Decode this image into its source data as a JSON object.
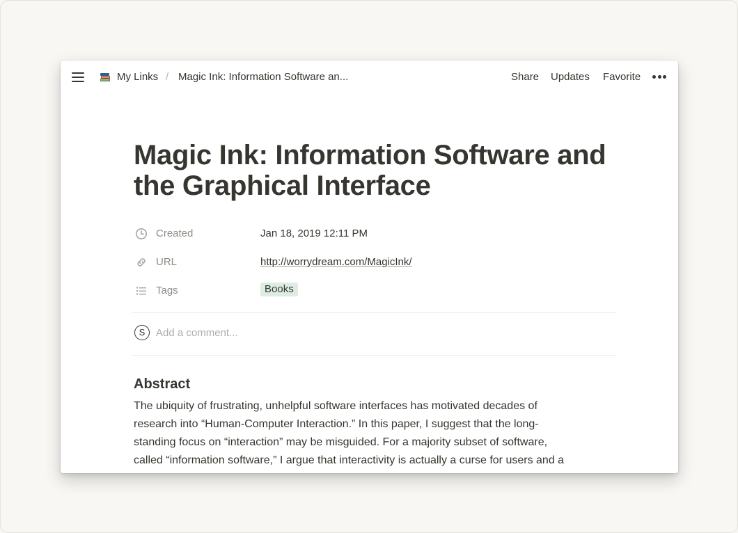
{
  "topbar": {
    "breadcrumb": [
      {
        "label": "My Links",
        "icon": "books-icon"
      },
      {
        "label": "Magic Ink: Information Software an..."
      }
    ],
    "separator": "/",
    "actions": {
      "share": "Share",
      "updates": "Updates",
      "favorite": "Favorite"
    }
  },
  "page": {
    "title": "Magic Ink: Information Software and the Graphical Interface",
    "properties": {
      "created": {
        "label": "Created",
        "value": "Jan 18, 2019 12:11 PM",
        "icon": "clock-icon"
      },
      "url": {
        "label": "URL",
        "value": "http://worrydream.com/MagicInk/",
        "icon": "link-icon"
      },
      "tags": {
        "label": "Tags",
        "value": "Books",
        "icon": "list-icon"
      }
    },
    "comment": {
      "avatar_initial": "S",
      "placeholder": "Add a comment..."
    },
    "body": {
      "heading": "Abstract",
      "lines": [
        "The ubiquity of frustrating, unhelpful software interfaces has motivated decades of",
        "research into “Human-Computer Interaction.” In this paper, I suggest that the long-",
        "standing focus on “interaction” may be misguided. For a majority subset of software,",
        "called “information software,” I argue that interactivity is actually a curse for users and a"
      ]
    }
  },
  "colors": {
    "background": "#f8f7f4",
    "text": "#37352f",
    "muted": "#8e8c87",
    "tag_bg": "#ddede4"
  }
}
